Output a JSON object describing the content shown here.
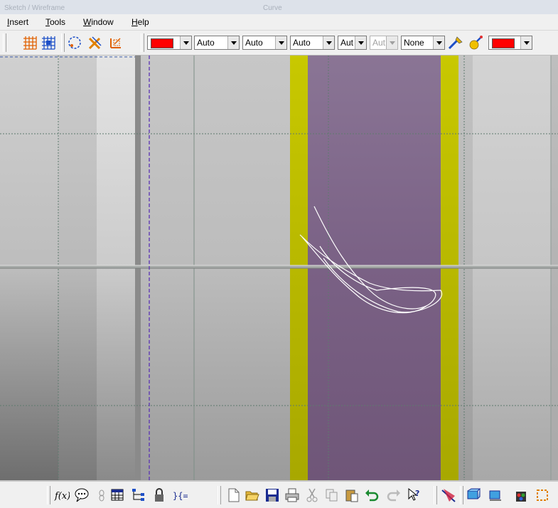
{
  "window": {
    "title_left": "Sketch / Wireframe",
    "title_center": "Curve"
  },
  "menu": [
    {
      "label": "Insert",
      "underline": "I",
      "rest": "nsert"
    },
    {
      "label": "Tools",
      "underline": "T",
      "rest": "ools"
    },
    {
      "label": "Window",
      "underline": "W",
      "rest": "indow"
    },
    {
      "label": "Help",
      "underline": "H",
      "rest": "elp"
    }
  ],
  "toolbar": {
    "color_fill": "#ff0000",
    "combos": [
      {
        "value": "Auto"
      },
      {
        "value": "Auto"
      },
      {
        "value": "Auto"
      },
      {
        "value": "Aut"
      },
      {
        "value": "Aut",
        "disabled": true
      },
      {
        "value": "None"
      }
    ],
    "color_line": "#ff0000",
    "icons": [
      "grid-icon",
      "snap-grid-icon",
      "sketch-circle-icon",
      "hide-show-icon",
      "axis-icon",
      "painter-icon",
      "render-icon"
    ]
  },
  "viewport": {
    "band_colors": {
      "yellow": "#c8c800",
      "purple": "#7a6185",
      "axis": "#5a32b4"
    }
  },
  "statusbar": {
    "icons": [
      "formula-icon",
      "comment-icon",
      "knowledge-icon",
      "table-icon",
      "tree-icon",
      "lock-icon",
      "parameter-icon",
      "new-file-icon",
      "open-folder-icon",
      "save-icon",
      "print-icon",
      "cut-icon",
      "copy-icon",
      "paste-icon",
      "undo-icon",
      "redo-icon",
      "help-cursor-icon",
      "measure-icon",
      "view-icon",
      "view2-icon",
      "apply-material-icon",
      "fit-icon"
    ],
    "formula_label": "f(x)"
  }
}
